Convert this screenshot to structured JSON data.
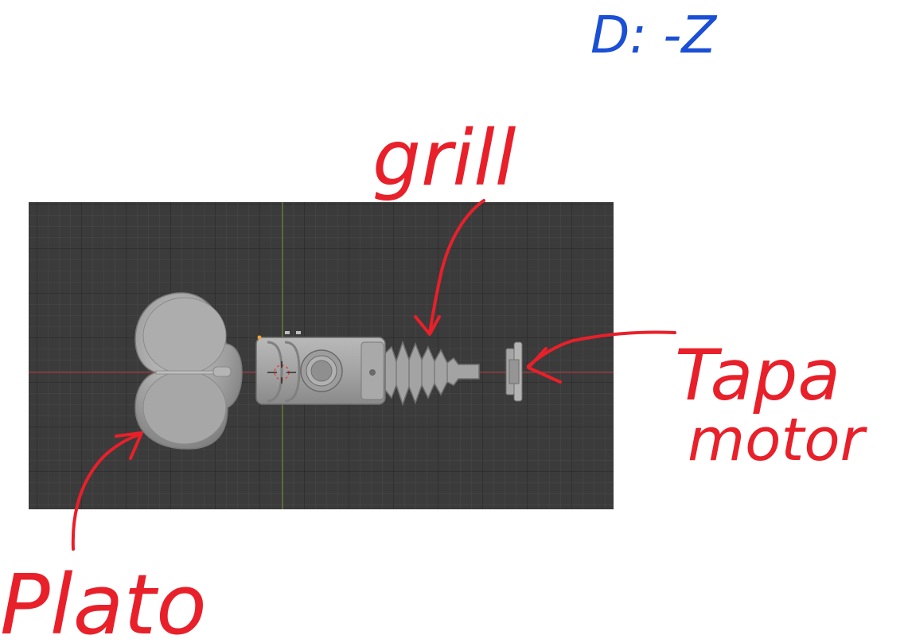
{
  "annotations": {
    "view_label": "D: -Z",
    "grill_label": "grill",
    "tapa_label_line1": "Tapa",
    "tapa_label_line2": "motor",
    "plato_label": "Plato"
  },
  "colors": {
    "annotation_red": "#e8202a",
    "annotation_blue": "#1a4fd6",
    "viewport_bg": "#3b3b3b",
    "axis_x": "#a03a44",
    "axis_y": "#6f8a2e",
    "mesh": "#a9a9a9"
  },
  "icons": {
    "cursor": "3d-cursor-icon",
    "origin": "object-origin-icon"
  }
}
